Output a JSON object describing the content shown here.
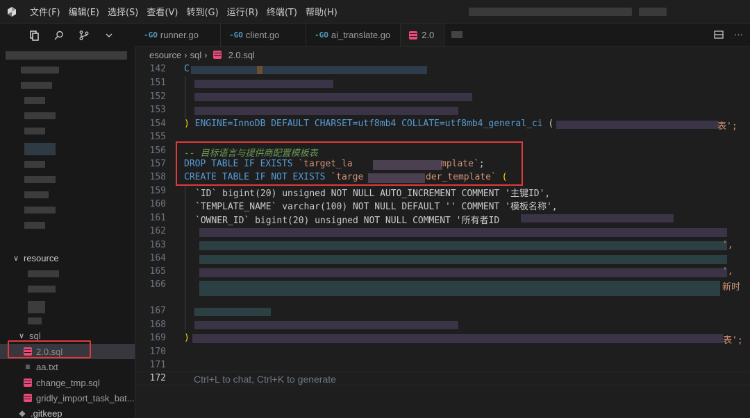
{
  "menu": [
    "文件(F)",
    "编辑(E)",
    "选择(S)",
    "查看(V)",
    "转到(G)",
    "运行(R)",
    "终端(T)",
    "帮助(H)"
  ],
  "tabs": [
    {
      "prefix": "-GO",
      "label": "runner.go"
    },
    {
      "prefix": "-GO",
      "label": "client.go"
    },
    {
      "prefix": "-GO",
      "label": "ai_translate.go"
    },
    {
      "prefix": "",
      "label": "2.0"
    }
  ],
  "breadcrumb": {
    "part1": "esource",
    "part2": "sql",
    "file": "2.0.sql"
  },
  "sidebar": {
    "folder_resource": "resource",
    "folder_sql": "sql",
    "files": [
      "2.0.sql",
      "aa.txt",
      "change_tmp.sql",
      "gridly_import_task_bat...",
      ".gitkeep"
    ]
  },
  "editor": {
    "line_numbers": [
      "142",
      "151",
      "152",
      "153",
      "154",
      "155",
      "156",
      "157",
      "158",
      "159",
      "160",
      "161",
      "162",
      "163",
      "164",
      "165",
      "166",
      "167",
      "168",
      "169",
      "170",
      "171",
      "172"
    ],
    "l142": "C",
    "l154_a": ") ENGINE=InnoDB DEFAULT CHARSET=utf8mb4 COLLATE=utf8mb4_general_ci (",
    "l154_b": "表';",
    "l156": "-- 目标语言与提供商配置模板表",
    "l157_a": "DROP TABLE IF EXISTS ",
    "l157_b": "`target_la",
    "l157_c": "mplate`",
    "l157_d": ";",
    "l158_a": "CREATE TABLE IF NOT EXISTS ",
    "l158_b": "`targe",
    "l158_c": "der_template`",
    "l158_d": " (",
    "l159": "`ID` bigint(20) unsigned NOT NULL AUTO_INCREMENT COMMENT '主键ID',",
    "l160": "`TEMPLATE_NAME` varchar(100) NOT NULL DEFAULT '' COMMENT '模板名称',",
    "l161": "`OWNER_ID` bigint(20) unsigned NOT NULL COMMENT '所有者ID",
    "l163_end": "',",
    "l165_end": "',",
    "l166_end": "新时",
    "l169_a": ")",
    "l169_b": "表';",
    "ghost": "Ctrl+L to chat, Ctrl+K to generate"
  }
}
